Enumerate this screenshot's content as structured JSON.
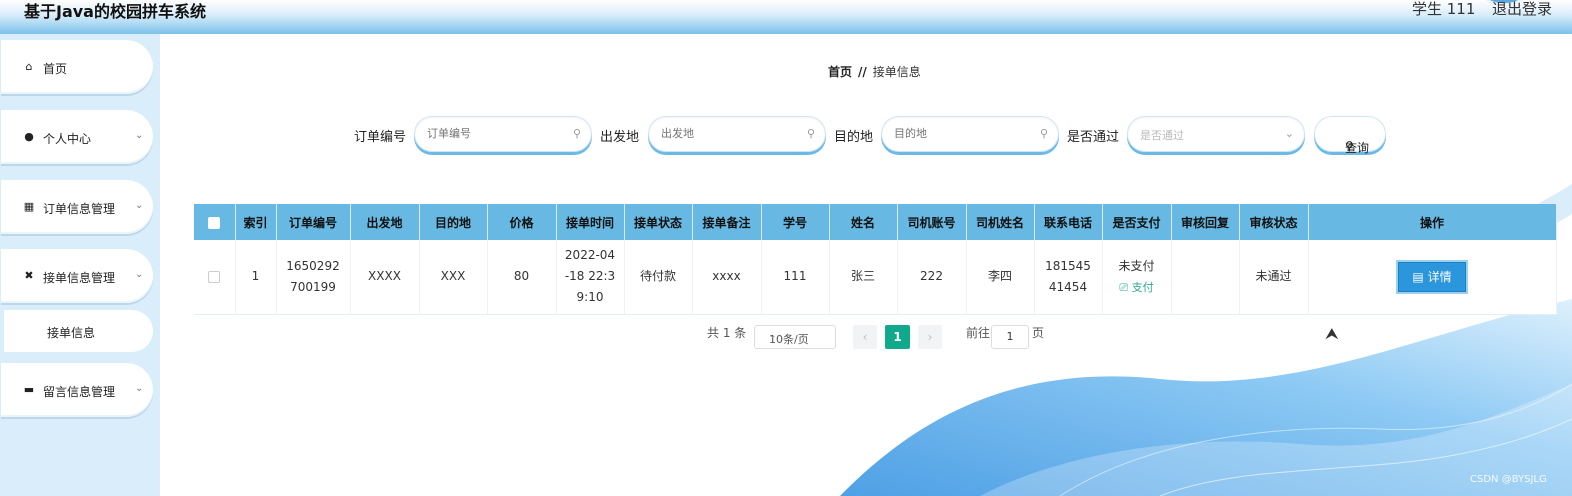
{
  "header": {
    "title": "基于Java的校园拼车系统",
    "user": "学生 111",
    "logout": "退出登录"
  },
  "sidebar": {
    "items": [
      {
        "label": "首页",
        "icon": "home-icon",
        "glyph": "⌂",
        "arrow": ""
      },
      {
        "label": "个人中心",
        "icon": "user-icon",
        "glyph": "●",
        "arrow": "⌄"
      },
      {
        "label": "订单信息管理",
        "icon": "grid-icon",
        "glyph": "▦",
        "arrow": "⌄"
      },
      {
        "label": "接单信息管理",
        "icon": "tool-icon",
        "glyph": "✖",
        "arrow": "⌄"
      },
      {
        "label": "留言信息管理",
        "icon": "briefcase-icon",
        "glyph": "▬",
        "arrow": "⌄"
      }
    ],
    "submenu": {
      "label": "接单信息"
    }
  },
  "breadcrumb": {
    "home": "首页",
    "sep": "//",
    "current": "接单信息"
  },
  "search": {
    "order_no": {
      "label": "订单编号",
      "placeholder": "订单编号"
    },
    "from": {
      "label": "出发地",
      "placeholder": "出发地"
    },
    "to": {
      "label": "目的地",
      "placeholder": "目的地"
    },
    "approved": {
      "label": "是否通过",
      "placeholder": "是否通过"
    },
    "query": "查询",
    "search_glyph": "⚲",
    "dropdown_glyph": "⌄"
  },
  "table": {
    "headers": [
      "索引",
      "订单编号",
      "出发地",
      "目的地",
      "价格",
      "接单时间",
      "接单状态",
      "接单备注",
      "学号",
      "姓名",
      "司机账号",
      "司机姓名",
      "联系电话",
      "是否支付",
      "审核回复",
      "审核状态",
      "操作"
    ],
    "rows": [
      {
        "index": "1",
        "order_no": "1650292700199",
        "from": "XXXX",
        "to": "XXX",
        "price": "80",
        "time": "2022-04-18 22:39:10",
        "status": "待付款",
        "remark": "xxxx",
        "student_no": "111",
        "name": "张三",
        "driver_account": "222",
        "driver_name": "李四",
        "phone": "18154541454",
        "paid": "未支付",
        "pay_action": "⎚ 支付",
        "review_reply": "",
        "review_status": "未通过",
        "detail": "▤ 详情"
      }
    ]
  },
  "pagination": {
    "total": "共 1 条",
    "page_size": "10条/页",
    "prev": "‹",
    "current": "1",
    "next": "›",
    "goto_prefix": "前往",
    "goto_value": "1",
    "goto_suffix": "页"
  },
  "watermark": "CSDN @BYSJLG",
  "colors": {
    "accent": "#67b9e3",
    "page_current": "#11a98b",
    "detail_button": "#2b96dc",
    "sidebar_bg": "#d9eefa"
  }
}
